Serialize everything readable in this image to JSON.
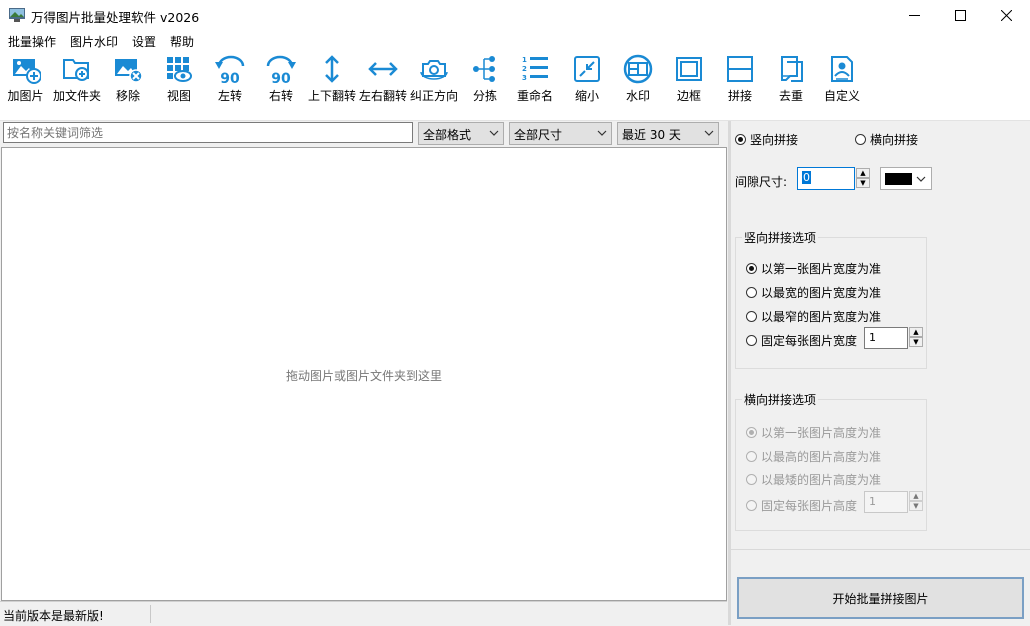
{
  "window": {
    "title": "万得图片批量处理软件 v2026"
  },
  "menu": [
    "批量操作",
    "图片水印",
    "设置",
    "帮助"
  ],
  "toolbar": {
    "add_image": "加图片",
    "add_folder": "加文件夹",
    "remove": "移除",
    "view": "视图",
    "rotate_left": "左转",
    "rotate_right": "右转",
    "flip_vertical": "上下翻转",
    "flip_horizontal": "左右翻转",
    "correct_orientation": "纠正方向",
    "sort": "分拣",
    "rename": "重命名",
    "shrink": "缩小",
    "watermark": "水印",
    "border": "边框",
    "stitch": "拼接",
    "dedupe": "去重",
    "custom": "自定义",
    "rotate_icon_text": "90"
  },
  "filter": {
    "search_placeholder": "按名称关键词筛选",
    "format": "全部格式",
    "size": "全部尺寸",
    "date": "最近 30 天"
  },
  "drop_hint": "拖动图片或图片文件夹到这里",
  "status": {
    "message": "当前版本是最新版!"
  },
  "panel": {
    "mode_vertical": "竖向拼接",
    "mode_horizontal": "横向拼接",
    "gap_label": "间隙尺寸:",
    "gap_value": "0",
    "gap_color": "#000000",
    "vertical_group": "竖向拼接选项",
    "vertical_options": [
      "以第一张图片宽度为准",
      "以最宽的图片宽度为准",
      "以最窄的图片宽度为准",
      "固定每张图片宽度"
    ],
    "vertical_fixed_value": "1",
    "horizontal_group": "横向拼接选项",
    "horizontal_options": [
      "以第一张图片高度为准",
      "以最高的图片高度为准",
      "以最矮的图片高度为准",
      "固定每张图片高度"
    ],
    "horizontal_fixed_value": "1",
    "start_button": "开始批量拼接图片"
  },
  "colors": {
    "accent": "#1a8ad4"
  }
}
